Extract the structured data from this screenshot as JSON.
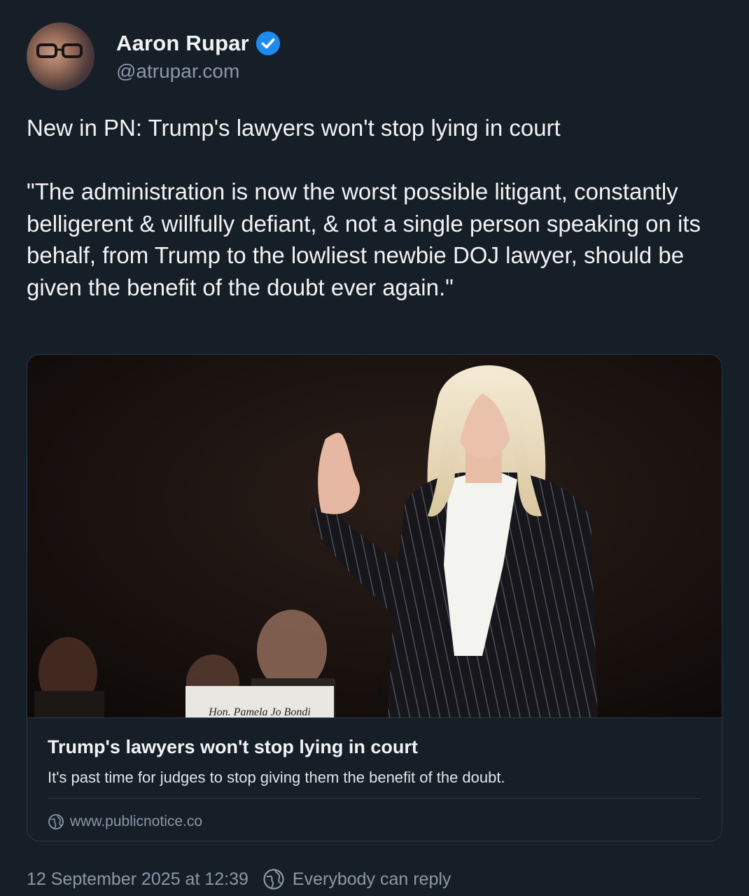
{
  "author": {
    "display_name": "Aaron Rupar",
    "handle": "@atrupar.com",
    "verified": true
  },
  "post": {
    "text": "New in PN: Trump's lawyers won't stop lying in court\n\n\"The administration is now the worst possible litigant, constantly belligerent & willfully defiant, & not a single person speaking on its behalf, from Trump to the lowliest newbie DOJ lawyer, should be given the benefit of the doubt ever again.\""
  },
  "link_card": {
    "image_placard_text": "Hon. Pamela Jo Bondi",
    "title": "Trump's lawyers won't stop lying in court",
    "description": "It's past time for judges to stop giving them the benefit of the doubt.",
    "domain": "www.publicnotice.co"
  },
  "footer": {
    "timestamp": "12 September 2025 at 12:39",
    "reply_setting": "Everybody can reply"
  },
  "colors": {
    "background": "#161e27",
    "verified_badge": "#1d8cf0",
    "muted_text": "#8b98a8",
    "border": "#2c3845"
  }
}
